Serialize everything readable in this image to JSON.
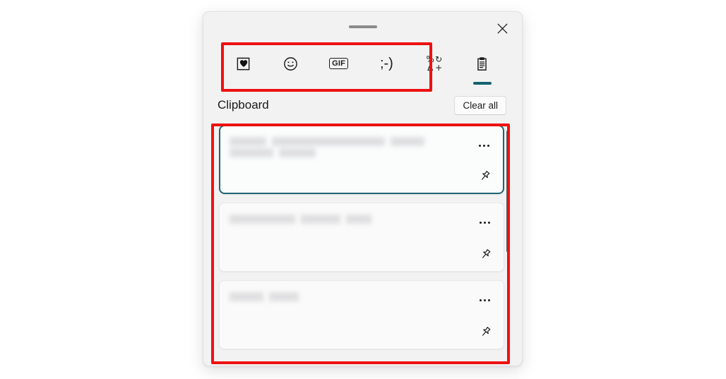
{
  "window": {
    "title": "Clipboard",
    "close_label": "Close",
    "drag_handle_label": "Drag handle"
  },
  "tabs": [
    {
      "id": "recently-used",
      "label": "Recently used",
      "icon": "heart-in-square-icon",
      "active": false
    },
    {
      "id": "emoji",
      "label": "Emoji",
      "icon": "smiley-face-icon",
      "active": false
    },
    {
      "id": "gif",
      "label": "GIF",
      "icon": "gif-icon",
      "active": false,
      "text": "GIF"
    },
    {
      "id": "kaomoji",
      "label": "Kaomoji",
      "icon": "kaomoji-icon",
      "active": false,
      "text": ";-)"
    },
    {
      "id": "symbols",
      "label": "Symbols",
      "icon": "symbols-icon",
      "active": false,
      "symbols": [
        "%",
        "↻",
        "Δ",
        "+"
      ]
    },
    {
      "id": "clipboard",
      "label": "Clipboard",
      "icon": "clipboard-icon",
      "active": true
    }
  ],
  "section": {
    "title": "Clipboard",
    "clear_all_label": "Clear all"
  },
  "clipboard_items": [
    {
      "id": "item-1",
      "focused": true,
      "content_redacted": true,
      "redaction_bars": [
        [
          52,
          13
        ],
        [
          160,
          13
        ],
        [
          48,
          13
        ],
        [
          62,
          13
        ],
        [
          52,
          13
        ]
      ],
      "menu_label": "More options",
      "pin_label": "Pin item"
    },
    {
      "id": "item-2",
      "focused": false,
      "content_redacted": true,
      "redaction_bars": [
        [
          93,
          13
        ],
        [
          56,
          13
        ],
        [
          36,
          13
        ]
      ],
      "menu_label": "More options",
      "pin_label": "Pin item"
    },
    {
      "id": "item-3",
      "focused": false,
      "content_redacted": true,
      "redaction_bars": [
        [
          48,
          13
        ],
        [
          42,
          13
        ]
      ],
      "menu_label": "More options",
      "pin_label": "Pin item"
    }
  ],
  "scrollbar": {
    "orientation": "vertical",
    "position_percent": 2
  },
  "annotations": [
    {
      "id": "annot-tabs",
      "target": "icon-tab-strip",
      "color": "#ee1111"
    },
    {
      "id": "annot-list",
      "target": "clipboard-item-list",
      "color": "#ee1111"
    }
  ],
  "colors": {
    "accent_teal": "#16616e",
    "focus_border": "#1d6472",
    "annotation_red": "#ee1111",
    "panel_bg": "#f2f2f2",
    "card_bg": "#fafafa",
    "page_bg": "#ffffff"
  }
}
